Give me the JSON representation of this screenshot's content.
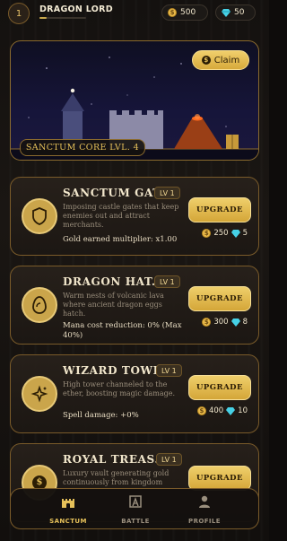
{
  "player": {
    "level": "1",
    "name": "DRAGON LORD",
    "xp_progress": 0.15
  },
  "currencies": {
    "gold": "500",
    "gems": "50"
  },
  "banner": {
    "claim_label": "Claim",
    "core_label": "SANCTUM CORE LVL. 4"
  },
  "buildings": [
    {
      "title": "SANCTUM GATE",
      "level": "LV 1",
      "description": "Imposing castle gates that keep enemies out and attract merchants.",
      "stat": "Gold earned multiplier: x1.00",
      "upgrade_label": "UPGRADE",
      "cost_gold": "250",
      "cost_gems": "5",
      "icon": "shield-icon"
    },
    {
      "title": "DRAGON HAT...",
      "level": "LV 1",
      "description": "Warm nests of volcanic lava where ancient dragon eggs hatch.",
      "stat": "Mana cost reduction: 0% (Max 40%)",
      "upgrade_label": "UPGRADE",
      "cost_gold": "300",
      "cost_gems": "8",
      "icon": "egg-icon"
    },
    {
      "title": "WIZARD TOWE...",
      "level": "LV 1",
      "description": "High tower channeled to the ether, boosting magic damage.",
      "stat": "Spell damage: +0%",
      "upgrade_label": "UPGRADE",
      "cost_gold": "400",
      "cost_gems": "10",
      "icon": "sparkles-icon"
    },
    {
      "title": "ROYAL TREAS...",
      "level": "LV 1",
      "description": "Luxury vault generating gold continuously from kingdom",
      "upgrade_label": "UPGRADE",
      "icon": "coins-icon"
    }
  ],
  "nav": {
    "sanctum": "SANCTUM",
    "battle": "BATTLE",
    "profile": "PROFILE",
    "active": "sanctum"
  },
  "colors": {
    "gold_accent": "#e6c15a",
    "gem": "#46d1e6",
    "border": "#7a5b2a"
  }
}
